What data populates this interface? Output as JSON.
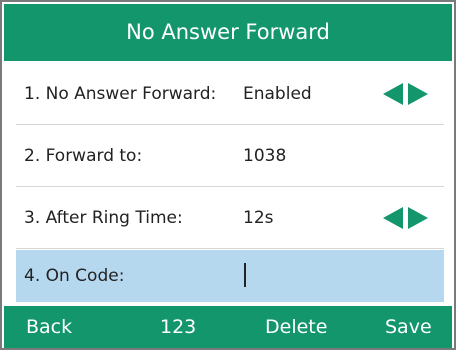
{
  "title": "No Answer Forward",
  "accent_color": "#13966c",
  "selected_row_color": "#b6d8ef",
  "rows": [
    {
      "label": "1. No Answer Forward:",
      "value": "Enabled",
      "control": "left-right-arrows"
    },
    {
      "label": "2. Forward to:",
      "value": "1038"
    },
    {
      "label": "3. After Ring Time:",
      "value": "12s",
      "control": "left-right-arrows"
    },
    {
      "label": "4. On Code:",
      "value": "",
      "state": "selected, text cursor"
    }
  ],
  "softkeys": [
    "Back",
    "123",
    "Delete",
    "Save"
  ]
}
